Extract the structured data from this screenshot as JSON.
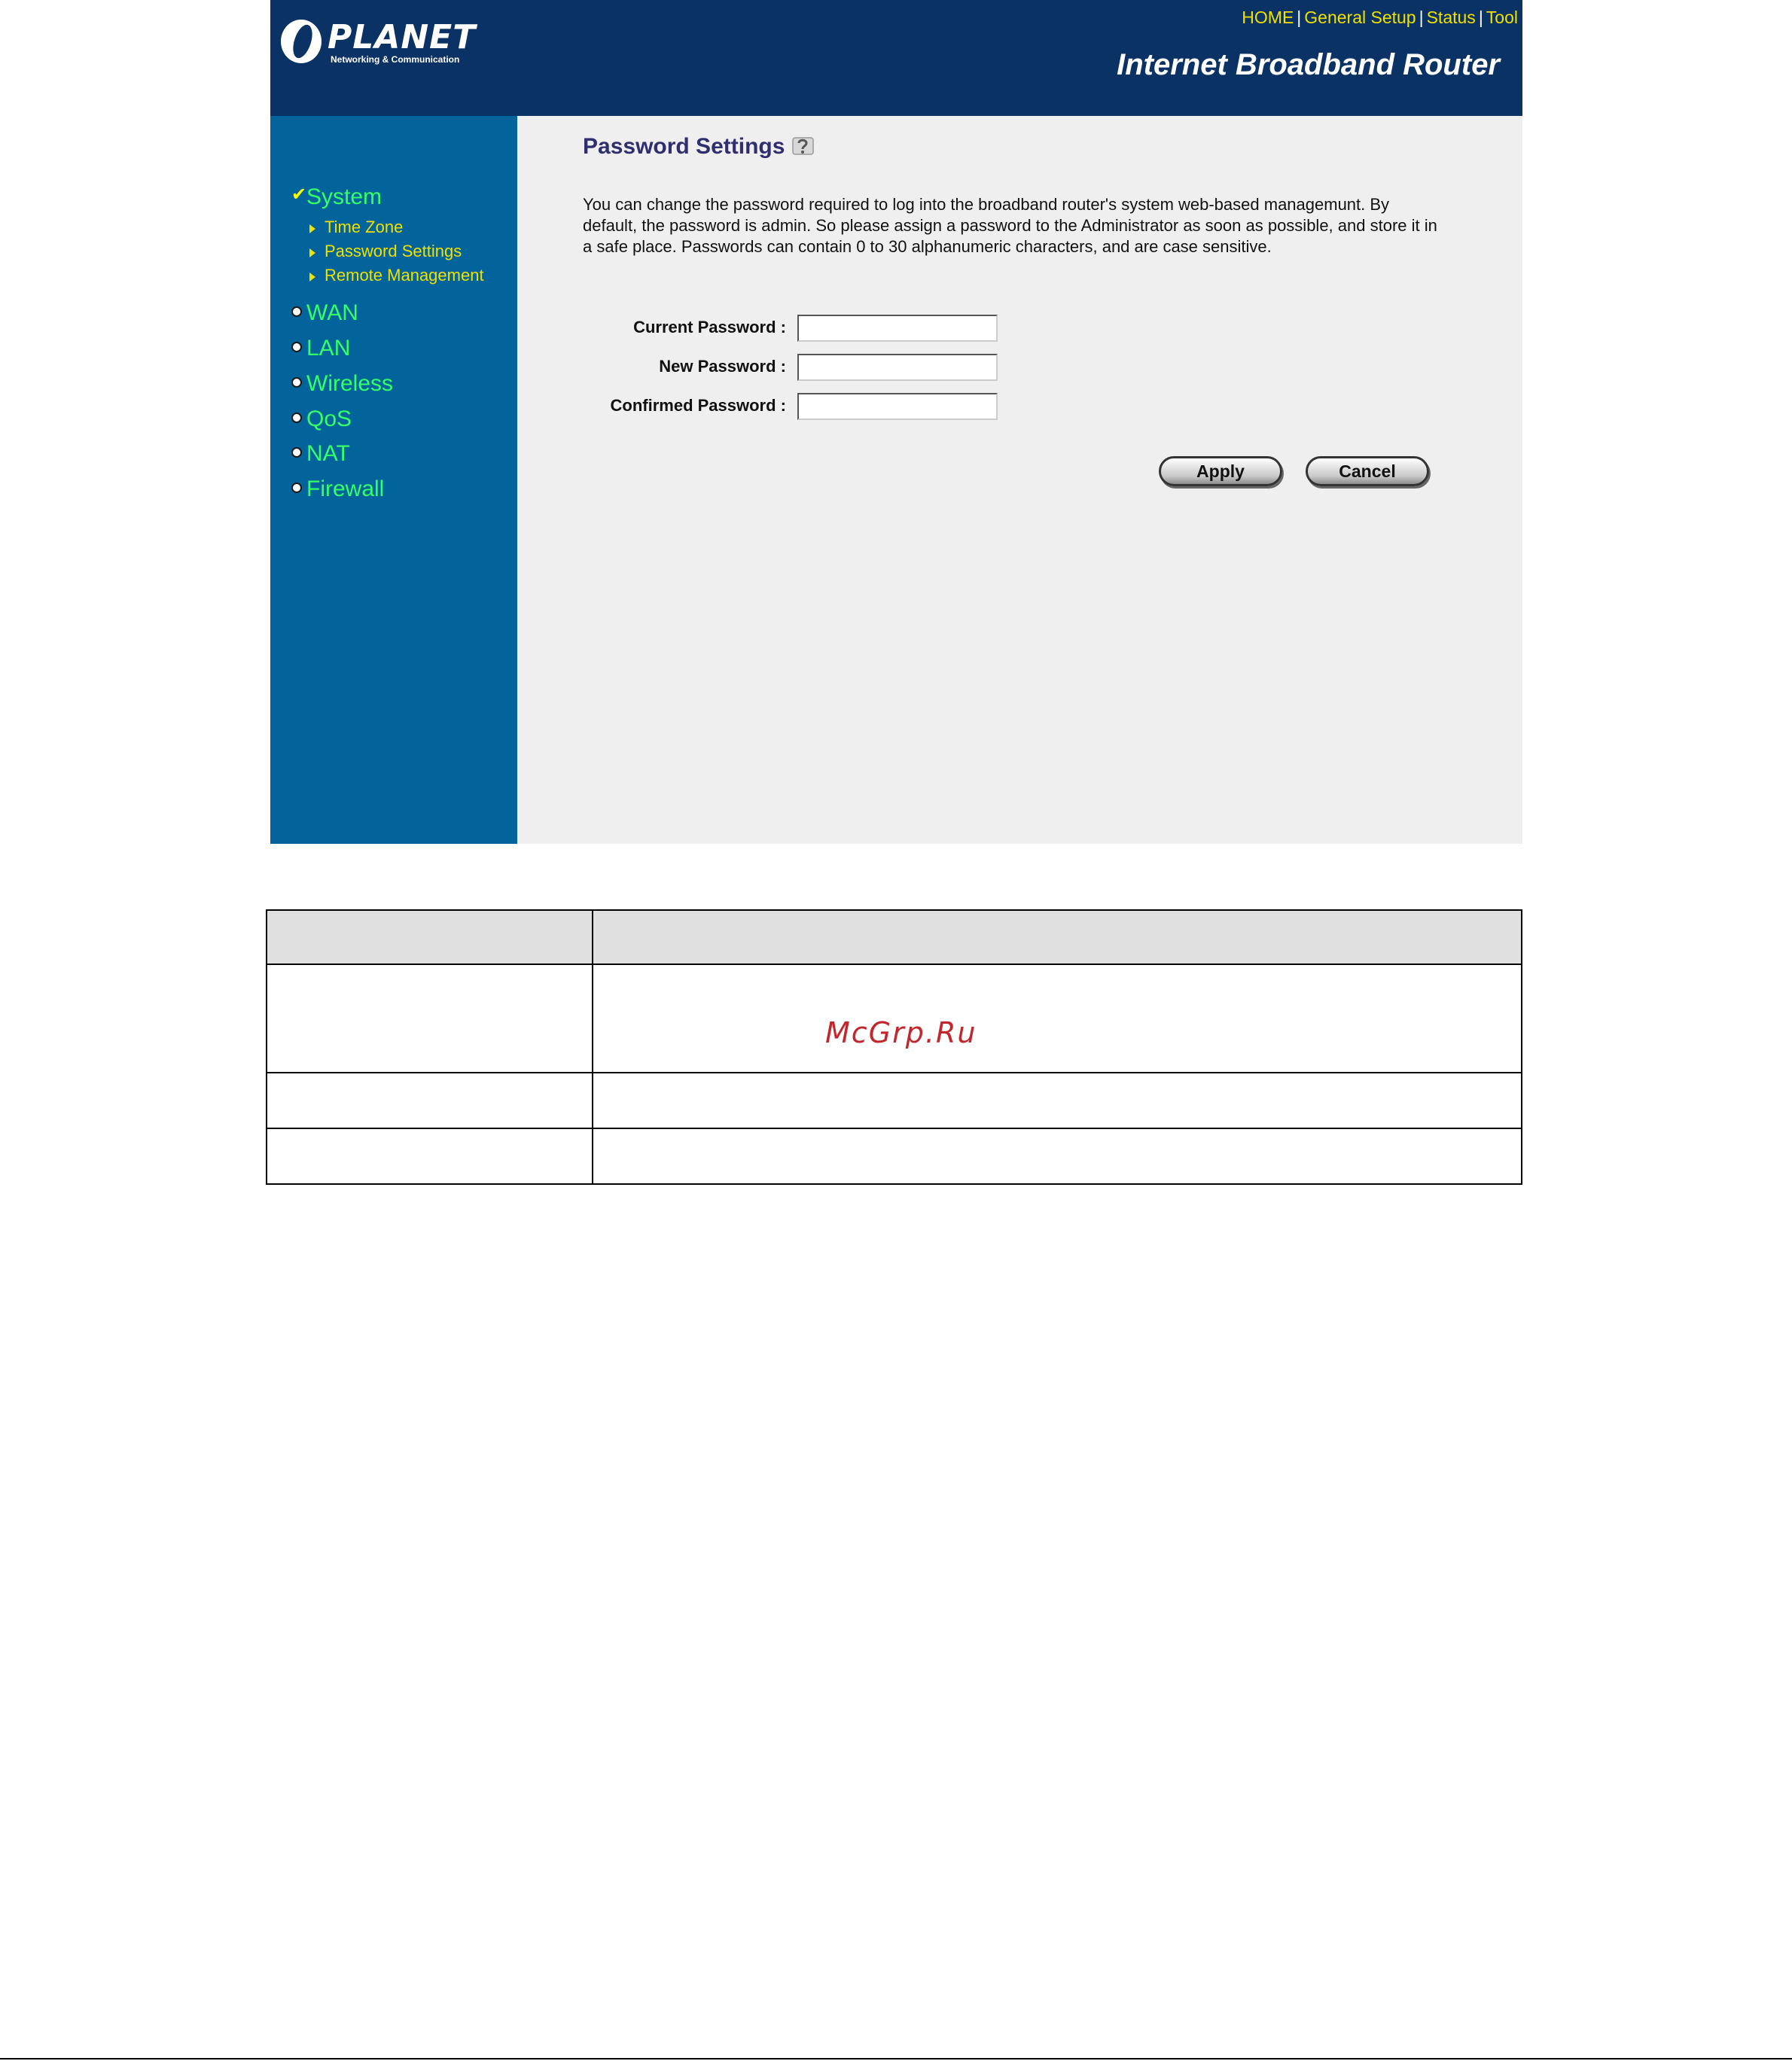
{
  "header": {
    "logo_text": "PLANET",
    "logo_tagline": "Networking & Communication",
    "nav": [
      "HOME",
      "General Setup",
      "Status",
      "Tool"
    ],
    "nav_separator": "|",
    "product_title": "Internet Broadband Router"
  },
  "sidebar": {
    "system_label": "System",
    "system_items": [
      "Time Zone",
      "Password Settings",
      "Remote Management"
    ],
    "menu": [
      "WAN",
      "LAN",
      "Wireless",
      "QoS",
      "NAT",
      "Firewall"
    ]
  },
  "main": {
    "title": "Password Settings",
    "description": "You can change the password required to log into the broadband router's system web-based managemunt. By default, the password is admin. So please assign a password to the Administrator as soon as possible, and store it in a safe place. Passwords can contain 0 to 30 alphanumeric characters, and are case sensitive.",
    "fields": {
      "current_label": "Current Password :",
      "new_label": "New Password :",
      "confirm_label": "Confirmed Password :",
      "current_value": "",
      "new_value": "",
      "confirm_value": ""
    },
    "buttons": {
      "apply": "Apply",
      "cancel": "Cancel"
    }
  },
  "document": {
    "watermark": "McGrp.Ru"
  },
  "colors": {
    "header_bg": "#0b3264",
    "sidebar_bg": "#02649b",
    "content_bg": "#efefef",
    "menu_green": "#33ff66",
    "link_yellow": "#f0e000",
    "title_navy": "#2f2f6f",
    "watermark_red": "#c0282e"
  }
}
